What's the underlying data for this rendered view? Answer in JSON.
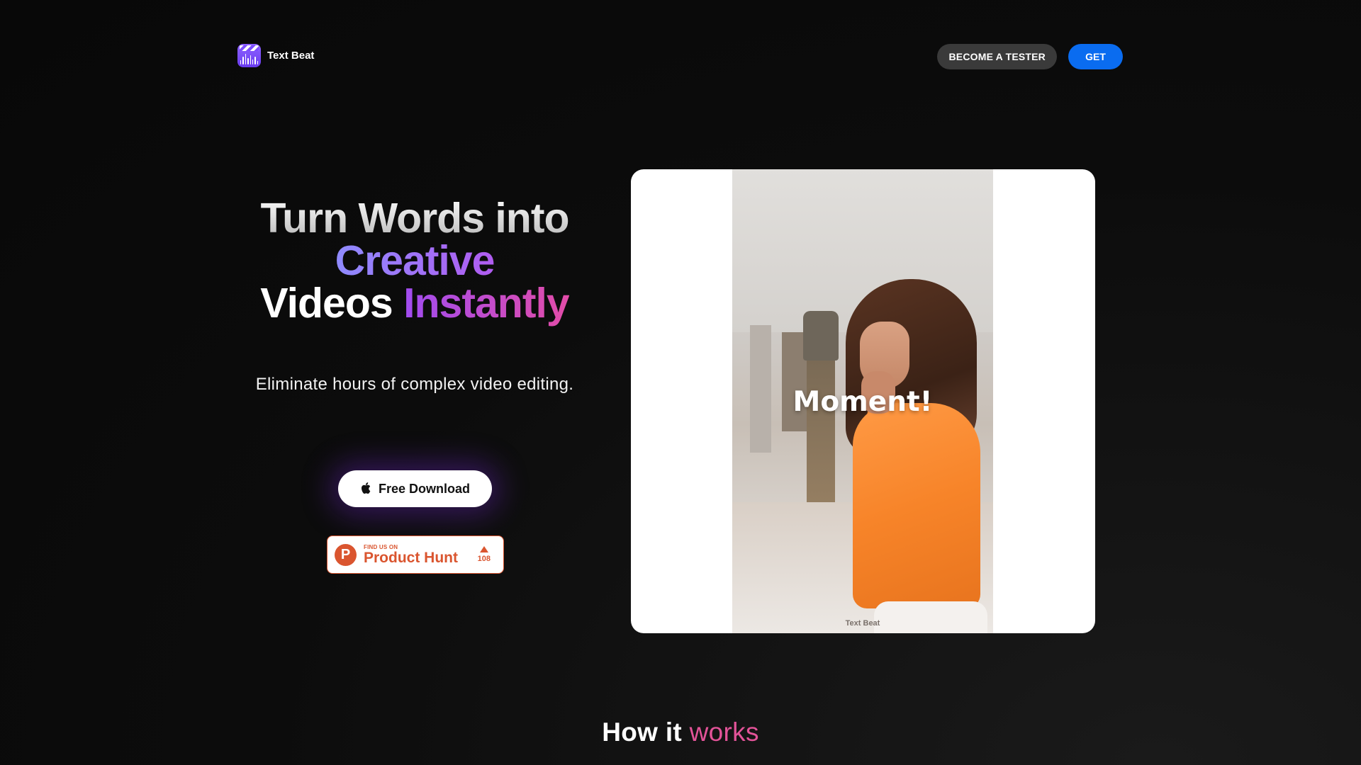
{
  "header": {
    "brand_name": "Text Beat",
    "logo_icon": "text-beat-app-icon",
    "become_tester_label": "BECOME A TESTER",
    "get_label": "GET"
  },
  "hero": {
    "title_line1": "Turn Words into",
    "title_line2": "Creative",
    "title_line3_a": "Videos",
    "title_line3_b": "Instantly",
    "subtitle": "Eliminate hours of complex video editing.",
    "download_label": "Free Download",
    "download_icon": "apple-icon"
  },
  "product_hunt": {
    "small_text": "FIND US ON",
    "name": "Product Hunt",
    "logo_letter": "P",
    "votes": "108"
  },
  "video": {
    "caption": "Moment!",
    "watermark": "Text Beat"
  },
  "how_it_works": {
    "title_a": "How it",
    "title_b": "works"
  },
  "colors": {
    "background": "#0c0c0c",
    "get_button": "#0a6cf0",
    "tester_button": "#3a3a3a",
    "product_hunt": "#da552f",
    "accent_purple": "#8f8bff",
    "accent_pink": "#e25398"
  }
}
